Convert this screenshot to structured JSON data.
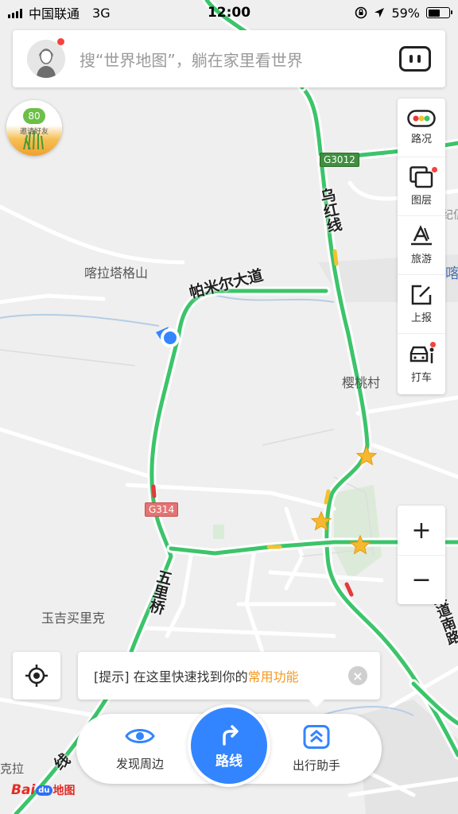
{
  "status_bar": {
    "carrier": "中国联通",
    "network": "3G",
    "time": "12:00",
    "battery": "59%",
    "battery_level": 0.59
  },
  "search": {
    "placeholder": "搜“世界地图”，躺在家里看世界"
  },
  "invite": {
    "count": "80",
    "label": "邀请好友"
  },
  "toolbar": {
    "items": [
      {
        "label": "路况",
        "icon": "traffic-light-icon"
      },
      {
        "label": "图层",
        "icon": "layers-icon"
      },
      {
        "label": "旅游",
        "icon": "travel-icon"
      },
      {
        "label": "上报",
        "icon": "report-icon"
      },
      {
        "label": "打车",
        "icon": "taxi-icon"
      }
    ]
  },
  "zoom": {
    "in": "+",
    "out": "−"
  },
  "tip": {
    "prefix": "[提示] 在这里快速找到你的",
    "highlight": "常用功能"
  },
  "bottom_bar": {
    "discover": "发现周边",
    "route": "路线",
    "assistant": "出行助手"
  },
  "logo": {
    "bai": "Bai",
    "du": "du",
    "ditu": "地图"
  },
  "map": {
    "places": [
      "喀拉塔格山",
      "樱桃村",
      "玉吉买里克",
      "克拉"
    ],
    "roads": [
      "帕米尔大道",
      "乌红线",
      "五里桥",
      "世纪大道南路",
      "线"
    ],
    "shields": [
      "G3012",
      "G314"
    ],
    "edge_labels": [
      "纪佤",
      "喀"
    ],
    "colors": {
      "road_green": "#3cc46a",
      "road_red": "#e23a3a",
      "road_yellow": "#f2c230",
      "accent_blue": "#3385ff",
      "highlight_orange": "#f39a22"
    }
  }
}
